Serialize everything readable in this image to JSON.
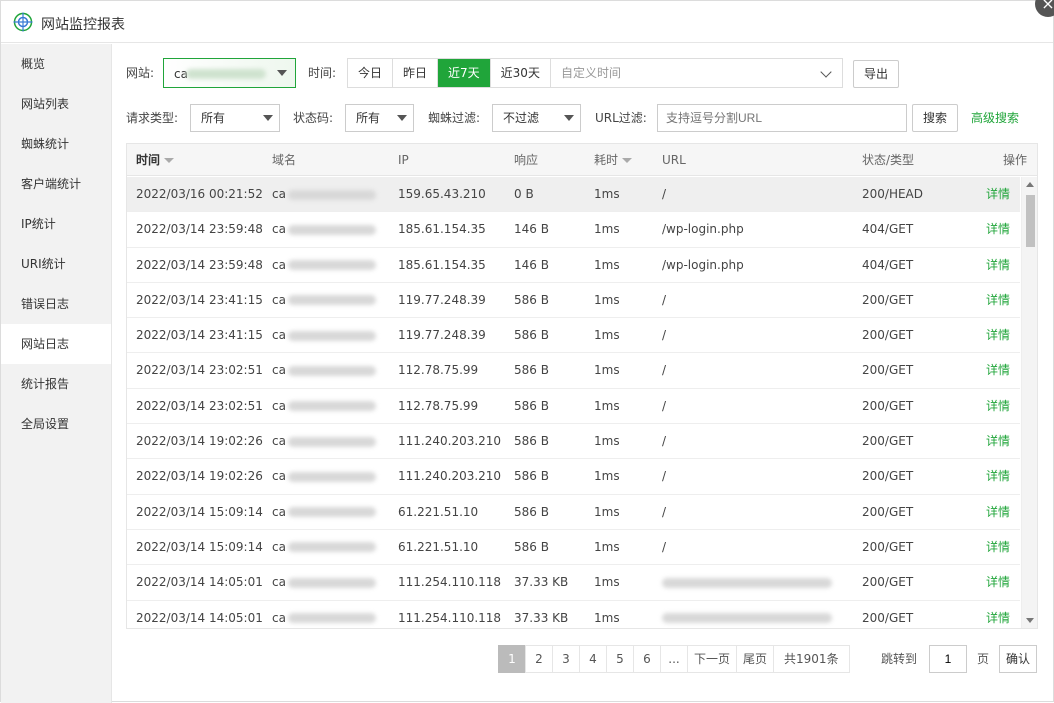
{
  "window": {
    "title": "网站监控报表"
  },
  "sidebar": {
    "items": [
      {
        "label": "概览"
      },
      {
        "label": "网站列表"
      },
      {
        "label": "蜘蛛统计"
      },
      {
        "label": "客户端统计"
      },
      {
        "label": "IP统计"
      },
      {
        "label": "URI统计"
      },
      {
        "label": "错误日志"
      },
      {
        "label": "网站日志"
      },
      {
        "label": "统计报告"
      },
      {
        "label": "全局设置"
      }
    ],
    "active_index": 7
  },
  "filters": {
    "site_label": "网站:",
    "site_value": "ca",
    "time_label": "时间:",
    "time_options": [
      "今日",
      "昨日",
      "近7天",
      "近30天"
    ],
    "time_active": "近7天",
    "custom_time_placeholder": "自定义时间",
    "export_label": "导出",
    "request_type_label": "请求类型:",
    "request_type_value": "所有",
    "status_label": "状态码:",
    "status_value": "所有",
    "spider_label": "蜘蛛过滤:",
    "spider_value": "不过滤",
    "url_label": "URL过滤:",
    "url_placeholder": "支持逗号分割URL",
    "search_label": "搜索",
    "advanced_label": "高级搜索"
  },
  "table": {
    "headers": {
      "time": "时间",
      "domain": "域名",
      "ip": "IP",
      "response": "响应",
      "duration": "耗时",
      "url": "URL",
      "status": "状态/类型",
      "action": "操作"
    },
    "rows": [
      {
        "time": "2022/03/16 00:21:52",
        "domain": "ca",
        "ip": "159.65.43.210",
        "response": "0 B",
        "duration": "1ms",
        "url": "/",
        "status": "200/HEAD",
        "action": "详情"
      },
      {
        "time": "2022/03/14 23:59:48",
        "domain": "ca",
        "ip": "185.61.154.35",
        "response": "146 B",
        "duration": "1ms",
        "url": "/wp-login.php",
        "status": "404/GET",
        "action": "详情"
      },
      {
        "time": "2022/03/14 23:59:48",
        "domain": "ca",
        "ip": "185.61.154.35",
        "response": "146 B",
        "duration": "1ms",
        "url": "/wp-login.php",
        "status": "404/GET",
        "action": "详情"
      },
      {
        "time": "2022/03/14 23:41:15",
        "domain": "ca",
        "ip": "119.77.248.39",
        "response": "586 B",
        "duration": "1ms",
        "url": "/",
        "status": "200/GET",
        "action": "详情"
      },
      {
        "time": "2022/03/14 23:41:15",
        "domain": "ca",
        "ip": "119.77.248.39",
        "response": "586 B",
        "duration": "1ms",
        "url": "/",
        "status": "200/GET",
        "action": "详情"
      },
      {
        "time": "2022/03/14 23:02:51",
        "domain": "ca",
        "ip": "112.78.75.99",
        "response": "586 B",
        "duration": "1ms",
        "url": "/",
        "status": "200/GET",
        "action": "详情"
      },
      {
        "time": "2022/03/14 23:02:51",
        "domain": "ca",
        "ip": "112.78.75.99",
        "response": "586 B",
        "duration": "1ms",
        "url": "/",
        "status": "200/GET",
        "action": "详情"
      },
      {
        "time": "2022/03/14 19:02:26",
        "domain": "ca",
        "ip": "111.240.203.210",
        "response": "586 B",
        "duration": "1ms",
        "url": "/",
        "status": "200/GET",
        "action": "详情"
      },
      {
        "time": "2022/03/14 19:02:26",
        "domain": "ca",
        "ip": "111.240.203.210",
        "response": "586 B",
        "duration": "1ms",
        "url": "/",
        "status": "200/GET",
        "action": "详情"
      },
      {
        "time": "2022/03/14 15:09:14",
        "domain": "ca",
        "ip": "61.221.51.10",
        "response": "586 B",
        "duration": "1ms",
        "url": "/",
        "status": "200/GET",
        "action": "详情"
      },
      {
        "time": "2022/03/14 15:09:14",
        "domain": "ca",
        "ip": "61.221.51.10",
        "response": "586 B",
        "duration": "1ms",
        "url": "/",
        "status": "200/GET",
        "action": "详情"
      },
      {
        "time": "2022/03/14 14:05:01",
        "domain": "ca",
        "ip": "111.254.110.118",
        "response": "37.33 KB",
        "duration": "1ms",
        "url": "",
        "status": "200/GET",
        "action": "详情"
      },
      {
        "time": "2022/03/14 14:05:01",
        "domain": "ca",
        "ip": "111.254.110.118",
        "response": "37.33 KB",
        "duration": "1ms",
        "url": "",
        "status": "200/GET",
        "action": "详情"
      }
    ]
  },
  "pagination": {
    "pages": [
      "1",
      "2",
      "3",
      "4",
      "5",
      "6",
      "..."
    ],
    "current": "1",
    "next_label": "下一页",
    "last_label": "尾页",
    "total_label": "共1901条",
    "jump_label": "跳转到",
    "jump_value": "1",
    "page_unit": "页",
    "confirm_label": "确认"
  },
  "colors": {
    "accent": "#20a53a"
  }
}
